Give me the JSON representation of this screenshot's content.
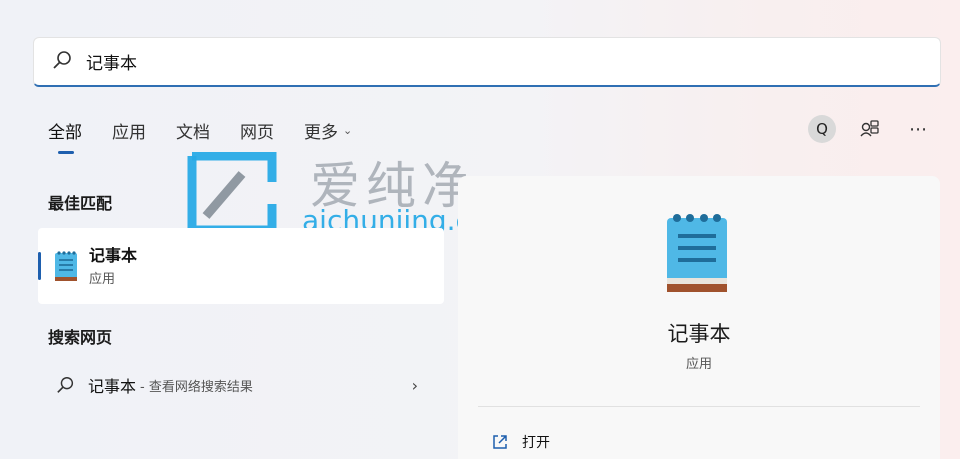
{
  "search": {
    "value": "记事本",
    "placeholder": ""
  },
  "tabs": [
    {
      "label": "全部"
    },
    {
      "label": "应用"
    },
    {
      "label": "文档"
    },
    {
      "label": "网页"
    },
    {
      "label": "更多"
    }
  ],
  "top_actions": {
    "avatar_letter": "Q"
  },
  "best_match": {
    "section_title": "最佳匹配",
    "name": "记事本",
    "type": "应用"
  },
  "web_search": {
    "section_title": "搜索网页",
    "query": "记事本",
    "suffix": "- 查看网络搜索结果"
  },
  "detail": {
    "name": "记事本",
    "type": "应用",
    "open_label": "打开"
  },
  "watermark": {
    "title": "爱纯净",
    "url": "aichunjing.com"
  },
  "colors": {
    "accent": "#1e5fae",
    "notepad_blue": "#4fb8e6",
    "notepad_brown": "#a0522d"
  }
}
